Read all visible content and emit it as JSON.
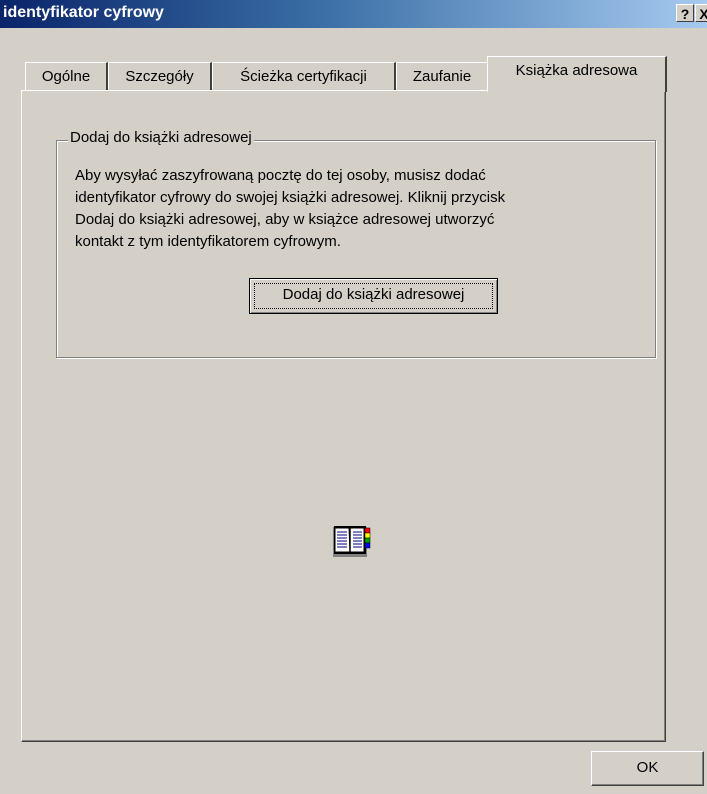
{
  "window": {
    "title": "identyfikator cyfrowy",
    "help_label": "?",
    "close_label": "X"
  },
  "tabs": [
    {
      "label": "Ogólne"
    },
    {
      "label": "Szczegóły"
    },
    {
      "label": "Ścieżka certyfikacji"
    },
    {
      "label": "Zaufanie"
    },
    {
      "label": "Książka adresowa"
    }
  ],
  "active_tab": "Książka adresowa",
  "group": {
    "label": "Dodaj do książki adresowej",
    "description_lines": [
      "Aby wysyłać zaszyfrowaną pocztę do tej osoby, musisz dodać",
      "identyfikator cyfrowy do swojej książki adresowej. Kliknij przycisk",
      "Dodaj do książki adresowej, aby w książce adresowej utworzyć",
      "kontakt z tym identyfikatorem cyfrowym."
    ],
    "button_label": "Dodaj do książki adresowej"
  },
  "icons": {
    "address_book": "address-book-icon"
  },
  "footer": {
    "ok_label": "OK"
  },
  "colors": {
    "title_start": "#0a246a",
    "title_end": "#a6caf0",
    "face": "#d4d0c8"
  }
}
